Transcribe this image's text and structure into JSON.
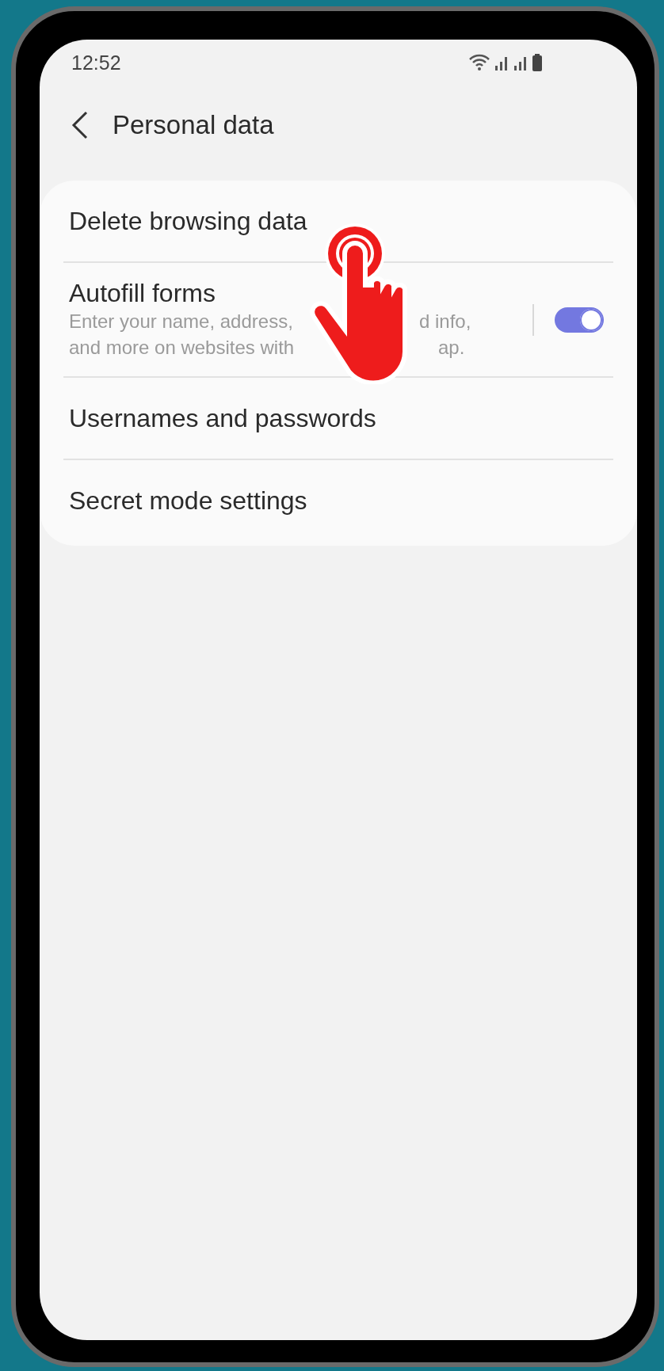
{
  "status_bar": {
    "time": "12:52"
  },
  "header": {
    "title": "Personal data"
  },
  "items": [
    {
      "kind": "plain",
      "title": "Delete browsing data"
    },
    {
      "kind": "toggle",
      "title": "Autofill forms",
      "subtitle_lines": [
        [
          "Enter your name, address,",
          "d info,"
        ],
        [
          "and more on websites with",
          "ap."
        ]
      ],
      "on": true
    },
    {
      "kind": "plain",
      "title": "Usernames and passwords"
    },
    {
      "kind": "plain",
      "title": "Secret mode settings"
    }
  ]
}
